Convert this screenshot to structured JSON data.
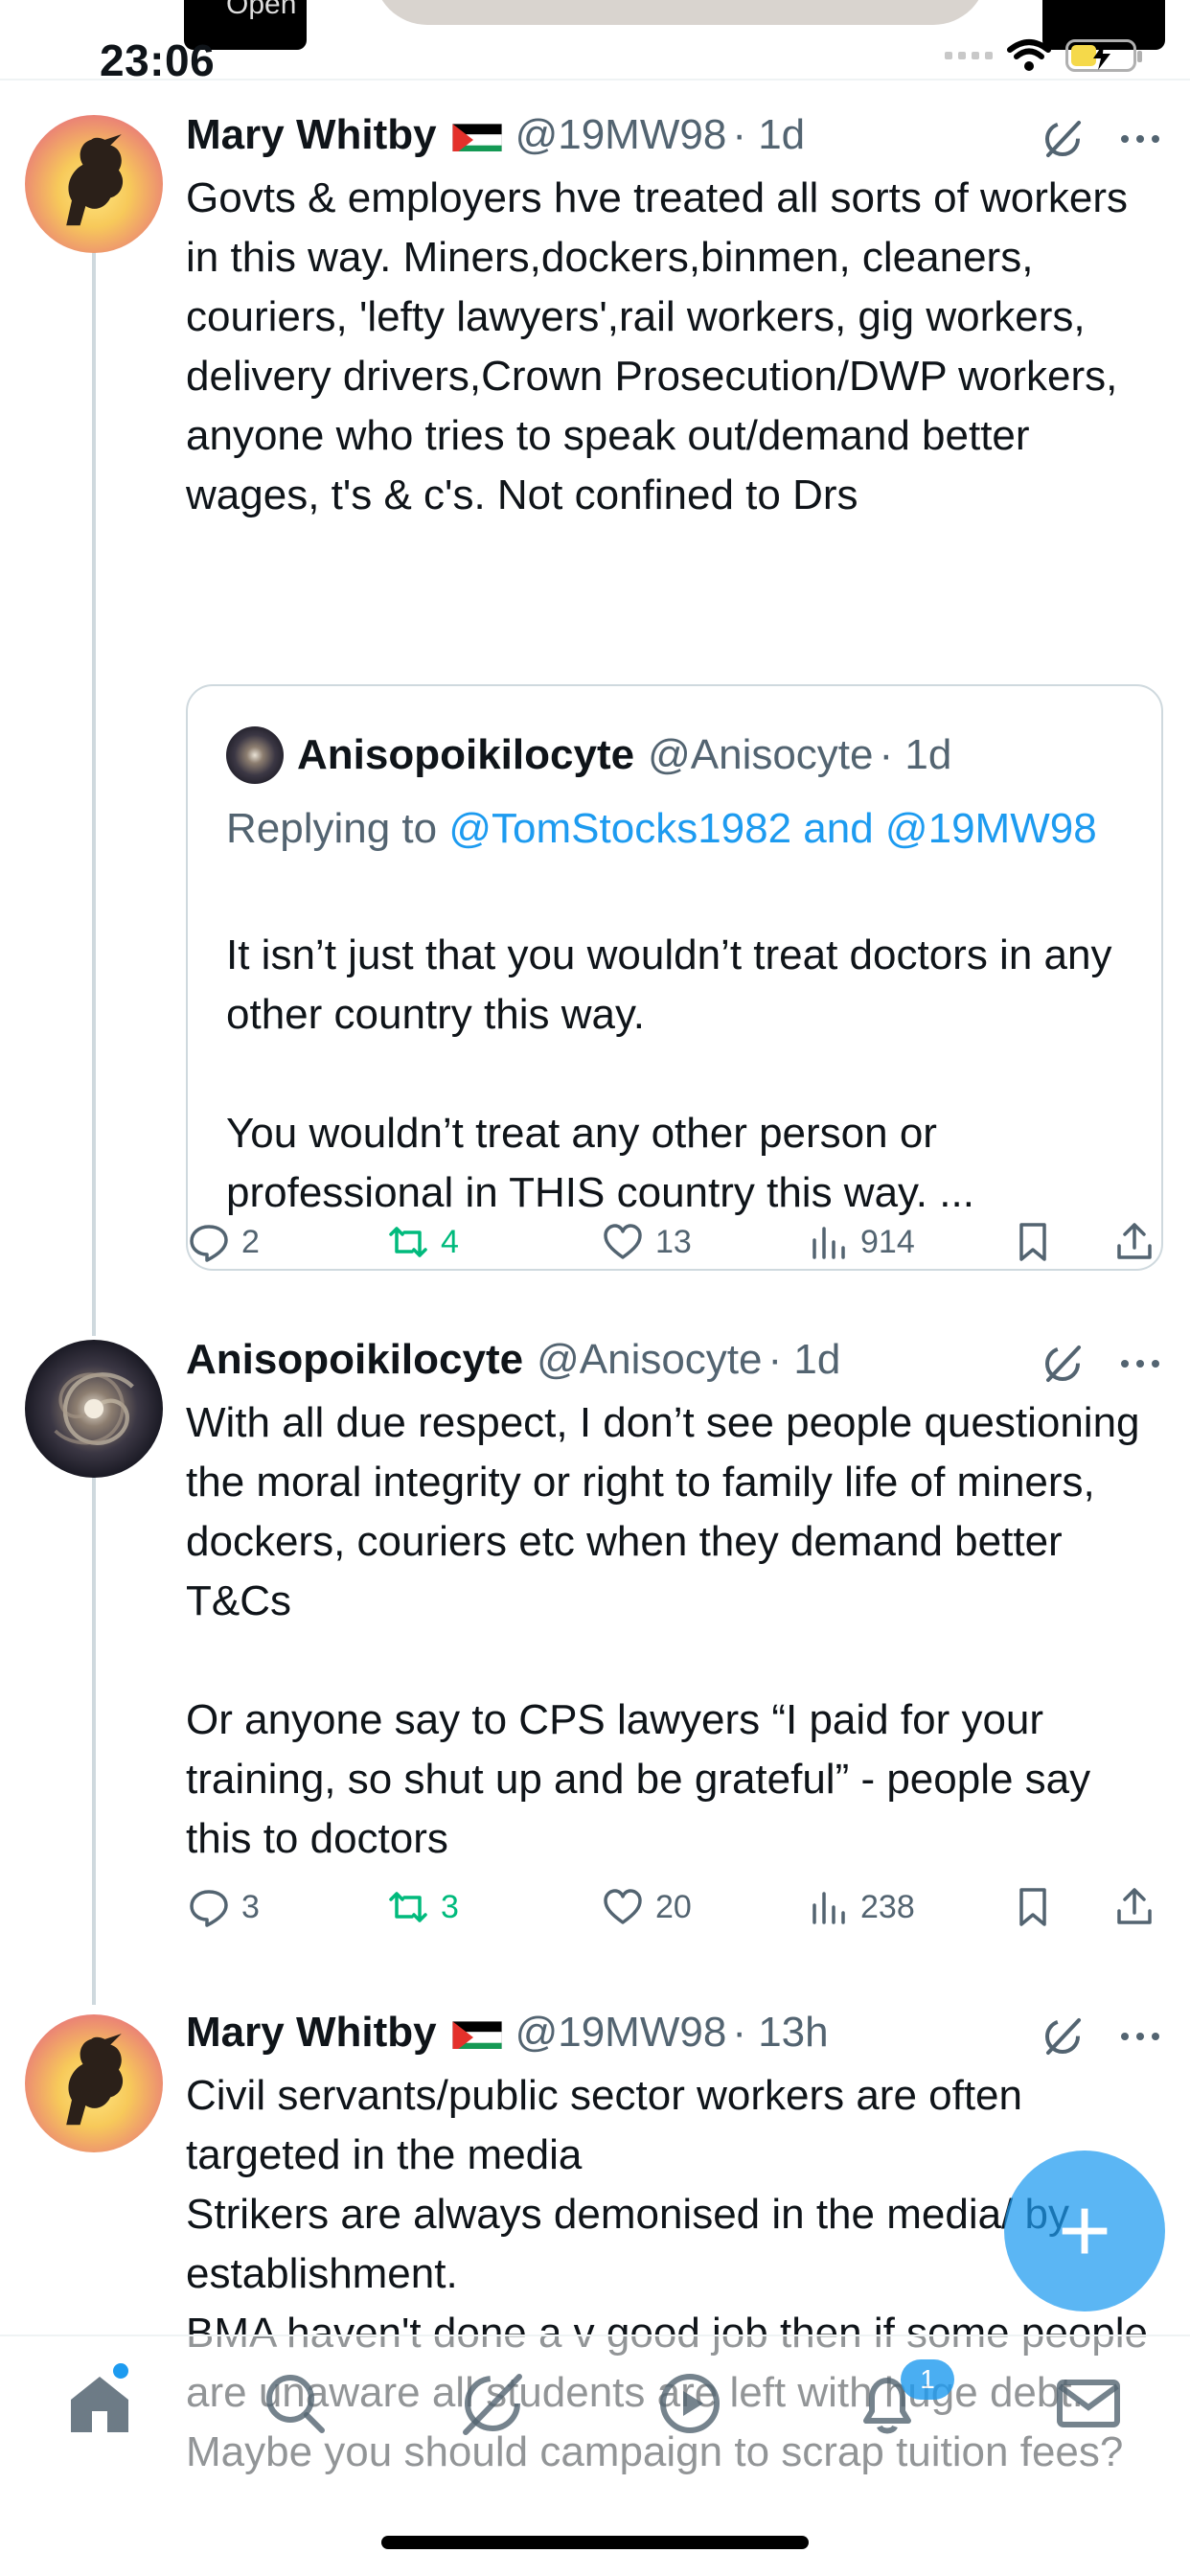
{
  "status_bar": {
    "time": "23:06",
    "open_label": "Open"
  },
  "tweets": [
    {
      "name": "Mary Whitby",
      "handle": "@19MW98",
      "time": "· 1d",
      "text": "Govts & employers hve treated all sorts of workers in this way. Miners,dockers,binmen, cleaners, couriers, 'lefty lawyers',rail workers, gig workers, delivery drivers,Crown Prosecution/DWP workers, anyone who tries to speak out/demand better wages, t's & c's. Not confined to Drs",
      "quote": {
        "name": "Anisopoikilocyte",
        "handle": "@Anisocyte",
        "time": "· 1d",
        "replying_prefix": "Replying to ",
        "replying_mentions": "@TomStocks1982 and @19MW98",
        "text": "It isn’t just that you wouldn’t treat doctors in any other country this way.\n\nYou wouldn’t treat any other person or professional in THIS country this way. ..."
      },
      "replies": "2",
      "reposts": "4",
      "likes": "13",
      "views": "914"
    },
    {
      "name": "Anisopoikilocyte",
      "handle": "@Anisocyte",
      "time": "· 1d",
      "text": "With all due respect, I don’t see people questioning the moral integrity or right to family life of miners, dockers, couriers etc when they demand better T&Cs\n\nOr anyone say to CPS lawyers “I paid for your training, so shut up and be grateful” - people say this to doctors",
      "replies": "3",
      "reposts": "3",
      "likes": "20",
      "views": "238"
    },
    {
      "name": "Mary Whitby",
      "handle": "@19MW98",
      "time": "· 13h",
      "text": "Civil servants/public sector workers are often targeted in the media\nStrikers are always demonised in the media/ by establishment.\nBMA haven't done a v good job then if some people are unaware all students are left with huge debt. Maybe you should campaign to scrap tuition fees?"
    }
  ],
  "fab": {
    "label": "+"
  },
  "nav": {
    "items": [
      "home-icon",
      "search-icon",
      "grok-icon",
      "play-icon",
      "bell-icon",
      "mail-icon"
    ],
    "notification_badge": "1"
  },
  "colors": {
    "accent": "#1d9bf0",
    "repost_green": "#00ba7c",
    "muted": "#536471"
  }
}
